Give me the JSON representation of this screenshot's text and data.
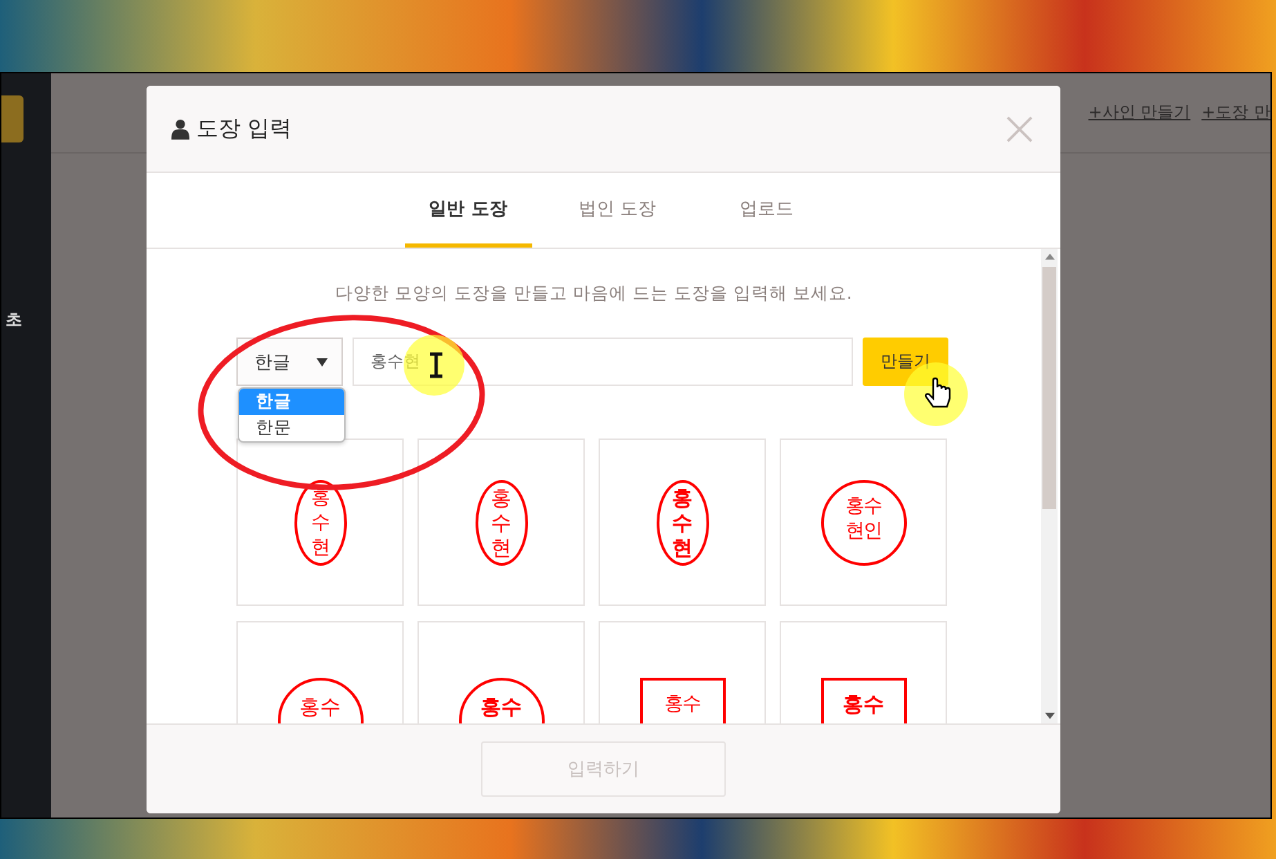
{
  "sidebar": {
    "items": [
      {
        "label": "초"
      }
    ]
  },
  "top_links": [
    "+사인 만들기",
    "+도장 만"
  ],
  "modal": {
    "title": "도장 입력",
    "tabs": [
      {
        "label": "일반 도장",
        "selected": true
      },
      {
        "label": "법인 도장",
        "selected": false
      },
      {
        "label": "업로드",
        "selected": false
      }
    ],
    "description": "다양한 모양의 도장을 만들고 마음에 드는 도장을 입력해 보세요.",
    "script_select": {
      "value": "한글",
      "expanded": true,
      "options": [
        {
          "label": "한글",
          "selected": true
        },
        {
          "label": "한문",
          "selected": false
        }
      ]
    },
    "name_field": {
      "value": "홍수현"
    },
    "create_button": "만들기",
    "stamps": [
      {
        "kind": "sealoval",
        "lines": [
          "홍",
          "수",
          "현"
        ]
      },
      {
        "kind": "oval",
        "lines": [
          "홍",
          "수",
          "현"
        ]
      },
      {
        "kind": "boldoval",
        "lines": [
          "홍",
          "수",
          "현"
        ]
      },
      {
        "kind": "sealcircle",
        "lines": [
          "홍수",
          "현인"
        ]
      },
      {
        "kind": "circle",
        "lines": [
          "홍수"
        ]
      },
      {
        "kind": "boldcircle",
        "lines": [
          "홍수"
        ]
      },
      {
        "kind": "sealsquare",
        "lines": [
          "홍수"
        ]
      },
      {
        "kind": "boldsquare",
        "lines": [
          "홍수"
        ]
      }
    ],
    "submit_button": {
      "label": "입력하기",
      "disabled": true
    }
  }
}
